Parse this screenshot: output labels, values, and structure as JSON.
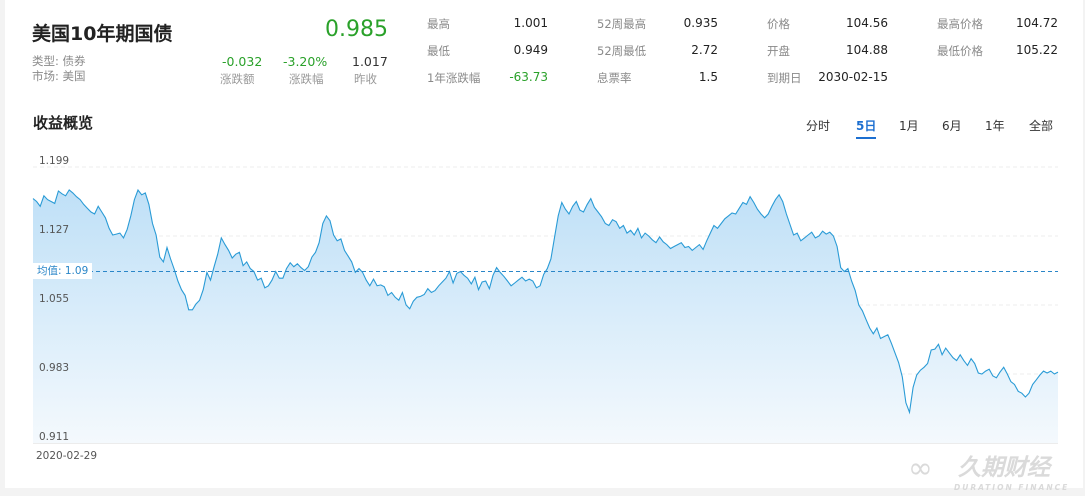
{
  "header": {
    "title": "美国10年期国债",
    "type_label": "类型: 债券",
    "market_label": "市场: 美国",
    "price": "0.985",
    "change_amount": "-0.032",
    "change_pct": "-3.20%",
    "prev_close": "1.017",
    "change_amount_label": "涨跌额",
    "change_pct_label": "涨跌幅",
    "prev_close_label": "昨收"
  },
  "stats": [
    {
      "label": "最高",
      "value": "1.001"
    },
    {
      "label": "最低",
      "value": "0.949"
    },
    {
      "label": "1年涨跌幅",
      "value": "-63.73"
    },
    {
      "label": "52周最高",
      "value": "0.935"
    },
    {
      "label": "52周最低",
      "value": "2.72"
    },
    {
      "label": "息票率",
      "value": "1.5"
    },
    {
      "label": "价格",
      "value": "104.56"
    },
    {
      "label": "开盘",
      "value": "104.88"
    },
    {
      "label": "到期日",
      "value": "2030-02-15"
    },
    {
      "label": "最高价格",
      "value": "104.72"
    },
    {
      "label": "最低价格",
      "value": "105.22"
    }
  ],
  "section": {
    "title": "收益概览",
    "tabs": [
      "分时",
      "5日",
      "1月",
      "6月",
      "1年",
      "全部"
    ],
    "active_tab": "5日"
  },
  "chart_data": {
    "type": "area",
    "title": "",
    "xlabel": "",
    "ylabel": "",
    "ylim": [
      0.911,
      1.199
    ],
    "y_ticks": [
      "1.199",
      "1.127",
      "1.055",
      "0.983",
      "0.911"
    ],
    "x_tick_label": "2020-02-29",
    "average_label": "均值: 1.09",
    "average": 1.09,
    "grid": true,
    "colors": {
      "line": "#2a9bd6",
      "fill_top": "#bfe0f7",
      "fill_bottom": "#f4f9fd",
      "avg_line": "#2a86c8"
    },
    "values": [
      1.166,
      1.163,
      1.158,
      1.169,
      1.165,
      1.163,
      1.161,
      1.174,
      1.171,
      1.169,
      1.175,
      1.172,
      1.168,
      1.165,
      1.16,
      1.156,
      1.152,
      1.15,
      1.158,
      1.152,
      1.146,
      1.135,
      1.128,
      1.129,
      1.13,
      1.125,
      1.134,
      1.148,
      1.165,
      1.175,
      1.17,
      1.172,
      1.16,
      1.14,
      1.128,
      1.105,
      1.1,
      1.115,
      1.103,
      1.092,
      1.08,
      1.071,
      1.065,
      1.05,
      1.05,
      1.056,
      1.06,
      1.071,
      1.089,
      1.081,
      1.095,
      1.108,
      1.125,
      1.118,
      1.112,
      1.104,
      1.108,
      1.11,
      1.096,
      1.1,
      1.093,
      1.09,
      1.081,
      1.083,
      1.073,
      1.075,
      1.081,
      1.09,
      1.083,
      1.083,
      1.093,
      1.099,
      1.095,
      1.098,
      1.094,
      1.091,
      1.095,
      1.105,
      1.11,
      1.12,
      1.14,
      1.148,
      1.143,
      1.128,
      1.122,
      1.124,
      1.112,
      1.106,
      1.1,
      1.089,
      1.093,
      1.089,
      1.081,
      1.075,
      1.082,
      1.075,
      1.076,
      1.074,
      1.065,
      1.068,
      1.063,
      1.06,
      1.068,
      1.055,
      1.051,
      1.059,
      1.063,
      1.064,
      1.066,
      1.072,
      1.068,
      1.07,
      1.075,
      1.079,
      1.083,
      1.09,
      1.078,
      1.088,
      1.09,
      1.086,
      1.083,
      1.077,
      1.084,
      1.071,
      1.079,
      1.08,
      1.072,
      1.086,
      1.094,
      1.089,
      1.085,
      1.08,
      1.075,
      1.078,
      1.081,
      1.084,
      1.08,
      1.082,
      1.08,
      1.073,
      1.075,
      1.087,
      1.093,
      1.103,
      1.126,
      1.148,
      1.162,
      1.155,
      1.15,
      1.158,
      1.163,
      1.154,
      1.152,
      1.16,
      1.166,
      1.157,
      1.152,
      1.147,
      1.14,
      1.138,
      1.144,
      1.142,
      1.135,
      1.138,
      1.13,
      1.133,
      1.128,
      1.135,
      1.125,
      1.13,
      1.127,
      1.123,
      1.12,
      1.126,
      1.121,
      1.118,
      1.114,
      1.116,
      1.118,
      1.12,
      1.115,
      1.116,
      1.112,
      1.115,
      1.118,
      1.113,
      1.122,
      1.13,
      1.138,
      1.135,
      1.14,
      1.145,
      1.148,
      1.151,
      1.15,
      1.156,
      1.162,
      1.16,
      1.168,
      1.162,
      1.155,
      1.15,
      1.146,
      1.15,
      1.158,
      1.165,
      1.17,
      1.163,
      1.15,
      1.139,
      1.128,
      1.13,
      1.122,
      1.125,
      1.128,
      1.131,
      1.125,
      1.127,
      1.132,
      1.129,
      1.131,
      1.127,
      1.116,
      1.094,
      1.09,
      1.093,
      1.08,
      1.07,
      1.055,
      1.049,
      1.04,
      1.031,
      1.025,
      1.031,
      1.02,
      1.022,
      1.024,
      1.015,
      1.005,
      0.995,
      0.98,
      0.953,
      0.943,
      0.969,
      0.982,
      0.987,
      0.99,
      0.994,
      1.008,
      1.009,
      1.014,
      1.003,
      1.01,
      1.005,
      1.0,
      0.997,
      1.003,
      0.997,
      0.992,
      0.999,
      0.994,
      0.984,
      0.983,
      0.986,
      0.988,
      0.981,
      0.979,
      0.985,
      0.99,
      0.983,
      0.975,
      0.972,
      0.965,
      0.963,
      0.959,
      0.963,
      0.972,
      0.977,
      0.982,
      0.986,
      0.984,
      0.986,
      0.983,
      0.985
    ]
  },
  "watermark": "久期财经 DURATION FINANCE"
}
